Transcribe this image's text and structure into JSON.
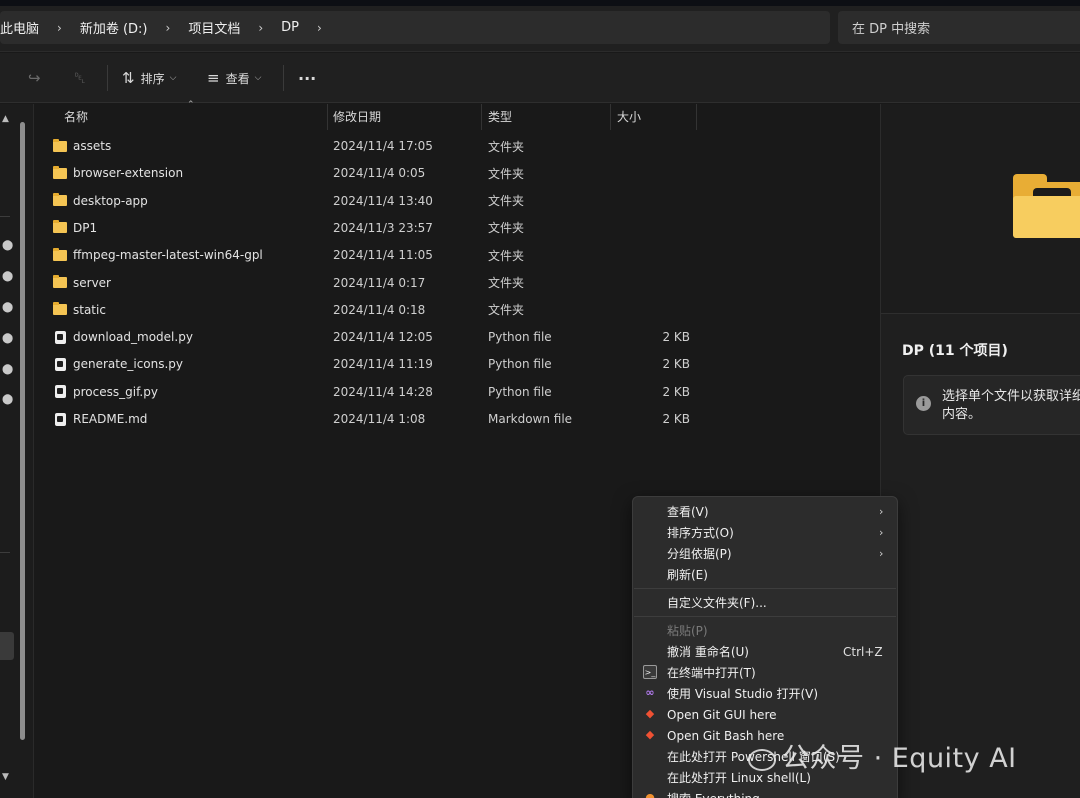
{
  "breadcrumb": [
    "此电脑",
    "新加卷 (D:)",
    "项目文档",
    "DP"
  ],
  "search": {
    "placeholder": "在 DP 中搜索"
  },
  "toolbar": {
    "sort_label": "排序",
    "view_label": "查看",
    "more_label": "···"
  },
  "columns": {
    "name": "名称",
    "date": "修改日期",
    "type": "类型",
    "size": "大小"
  },
  "files": [
    {
      "name": "assets",
      "date": "2024/11/4 17:05",
      "type": "文件夹",
      "size": "",
      "kind": "folder"
    },
    {
      "name": "browser-extension",
      "date": "2024/11/4 0:05",
      "type": "文件夹",
      "size": "",
      "kind": "folder"
    },
    {
      "name": "desktop-app",
      "date": "2024/11/4 13:40",
      "type": "文件夹",
      "size": "",
      "kind": "folder"
    },
    {
      "name": "DP1",
      "date": "2024/11/3 23:57",
      "type": "文件夹",
      "size": "",
      "kind": "folder"
    },
    {
      "name": "ffmpeg-master-latest-win64-gpl",
      "date": "2024/11/4 11:05",
      "type": "文件夹",
      "size": "",
      "kind": "folder"
    },
    {
      "name": "server",
      "date": "2024/11/4 0:17",
      "type": "文件夹",
      "size": "",
      "kind": "folder"
    },
    {
      "name": "static",
      "date": "2024/11/4 0:18",
      "type": "文件夹",
      "size": "",
      "kind": "folder"
    },
    {
      "name": "download_model.py",
      "date": "2024/11/4 12:05",
      "type": "Python file",
      "size": "2 KB",
      "kind": "file"
    },
    {
      "name": "generate_icons.py",
      "date": "2024/11/4 11:19",
      "type": "Python file",
      "size": "2 KB",
      "kind": "file"
    },
    {
      "name": "process_gif.py",
      "date": "2024/11/4 14:28",
      "type": "Python file",
      "size": "2 KB",
      "kind": "file"
    },
    {
      "name": "README.md",
      "date": "2024/11/4 1:08",
      "type": "Markdown file",
      "size": "2 KB",
      "kind": "file"
    }
  ],
  "details": {
    "title": "DP (11 个项目)",
    "info": "选择单个文件以获取详细内容。"
  },
  "context_menu": {
    "view": "查看(V)",
    "sort": "排序方式(O)",
    "group": "分组依据(P)",
    "refresh": "刷新(E)",
    "customize": "自定义文件夹(F)...",
    "paste": "粘贴(P)",
    "undo": "撤消 重命名(U)",
    "undo_shortcut": "Ctrl+Z",
    "terminal": "在终端中打开(T)",
    "visual_studio": "使用 Visual Studio 打开(V)",
    "git_gui": "Open Git GUI here",
    "git_bash": "Open Git Bash here",
    "powershell": "在此处打开 Powershell 窗口(S)",
    "linux_shell": "在此处打开 Linux shell(L)",
    "everything": "搜索 Everything"
  },
  "watermark": "公众号 · Equity AI",
  "colors": {
    "folder": "#f4c453",
    "menu_bg": "#2c2c2c",
    "window_bg": "#191919"
  }
}
